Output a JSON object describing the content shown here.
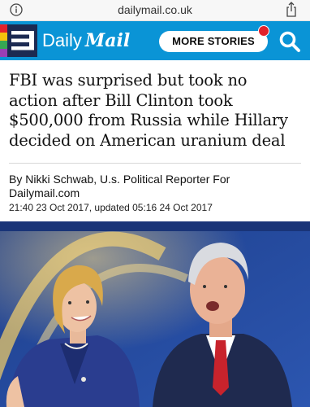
{
  "browser": {
    "url": "dailymail.co.uk",
    "icons": [
      "info-icon",
      "share-icon"
    ]
  },
  "header": {
    "brand_daily": "Daily",
    "brand_mail": "Mail",
    "more_stories_label": "MORE STORIES",
    "icons": [
      "menu-icon",
      "search-icon"
    ],
    "colors": {
      "bar": "#0a94d6",
      "notification": "#e3222b"
    }
  },
  "article": {
    "headline_lines": [
      "FBI was surprised but took no",
      "action after Bill Clinton took",
      "$500,000 from Russia while Hillary",
      "decided on American uranium deal"
    ],
    "byline_line1": "By Nikki Schwab, U.s. Political Reporter For",
    "byline_line2": "Dailymail.com",
    "dateline": "21:40 23 Oct 2017, updated 05:16 24 Oct 2017"
  }
}
